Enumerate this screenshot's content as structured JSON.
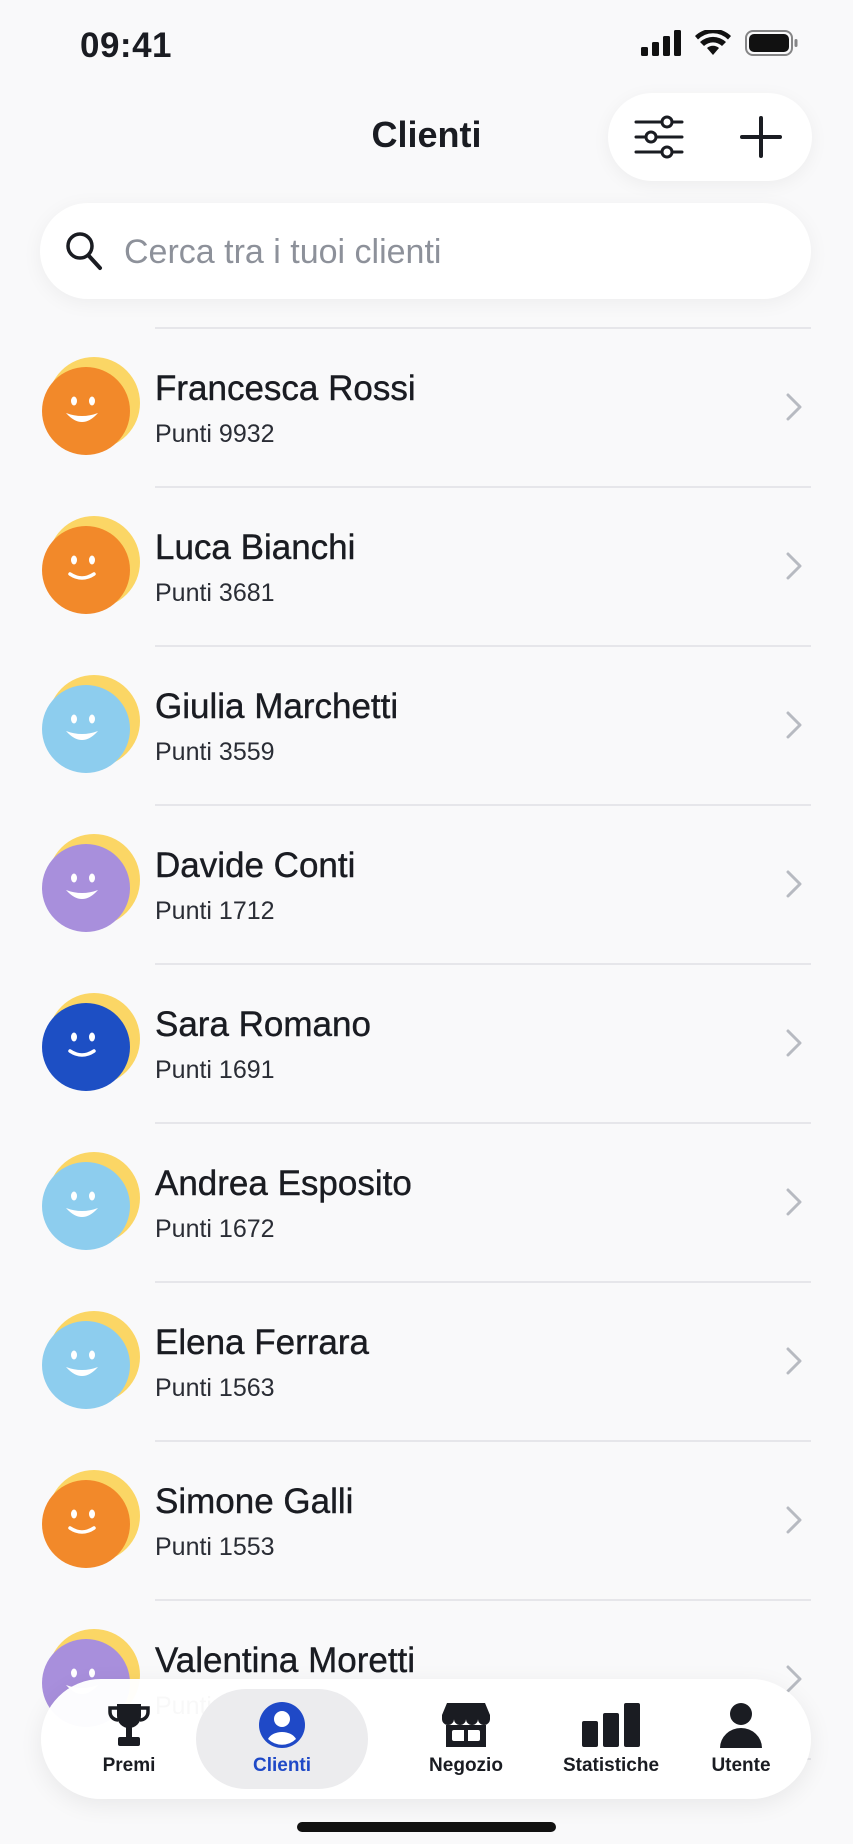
{
  "status_bar": {
    "time": "09:41"
  },
  "header": {
    "title": "Clienti",
    "filter_icon": "sliders-icon",
    "add_icon": "plus-icon"
  },
  "search": {
    "placeholder": "Cerca tra i tuoi clienti"
  },
  "clients": [
    {
      "name": "Francesca Rossi",
      "points": "Punti 9932",
      "avatar_color": "#f2892a"
    },
    {
      "name": "Luca Bianchi",
      "points": "Punti 3681",
      "avatar_color": "#f2892a"
    },
    {
      "name": "Giulia Marchetti",
      "points": "Punti 3559",
      "avatar_color": "#8dcdee"
    },
    {
      "name": "Davide Conti",
      "points": "Punti 1712",
      "avatar_color": "#a88fdc"
    },
    {
      "name": "Sara Romano",
      "points": "Punti 1691",
      "avatar_color": "#1d4fc4"
    },
    {
      "name": "Andrea Esposito",
      "points": "Punti 1672",
      "avatar_color": "#8dcdee"
    },
    {
      "name": "Elena Ferrara",
      "points": "Punti 1563",
      "avatar_color": "#8dcdee"
    },
    {
      "name": "Simone Galli",
      "points": "Punti 1553",
      "avatar_color": "#f2892a"
    },
    {
      "name": "Valentina Moretti",
      "points": "Punti",
      "avatar_color": "#a88fdc"
    }
  ],
  "tab_bar": {
    "tabs": [
      {
        "label": "Premi",
        "icon": "trophy-icon"
      },
      {
        "label": "Clienti",
        "icon": "person-circle-icon",
        "active": true
      },
      {
        "label": "Negozio",
        "icon": "store-icon"
      },
      {
        "label": "Statistiche",
        "icon": "bar-chart-icon"
      },
      {
        "label": "Utente",
        "icon": "person-icon"
      }
    ]
  },
  "colors": {
    "accent": "#1f49c7",
    "avatar_ring": "#fbd665",
    "text": "#1a1c22"
  }
}
